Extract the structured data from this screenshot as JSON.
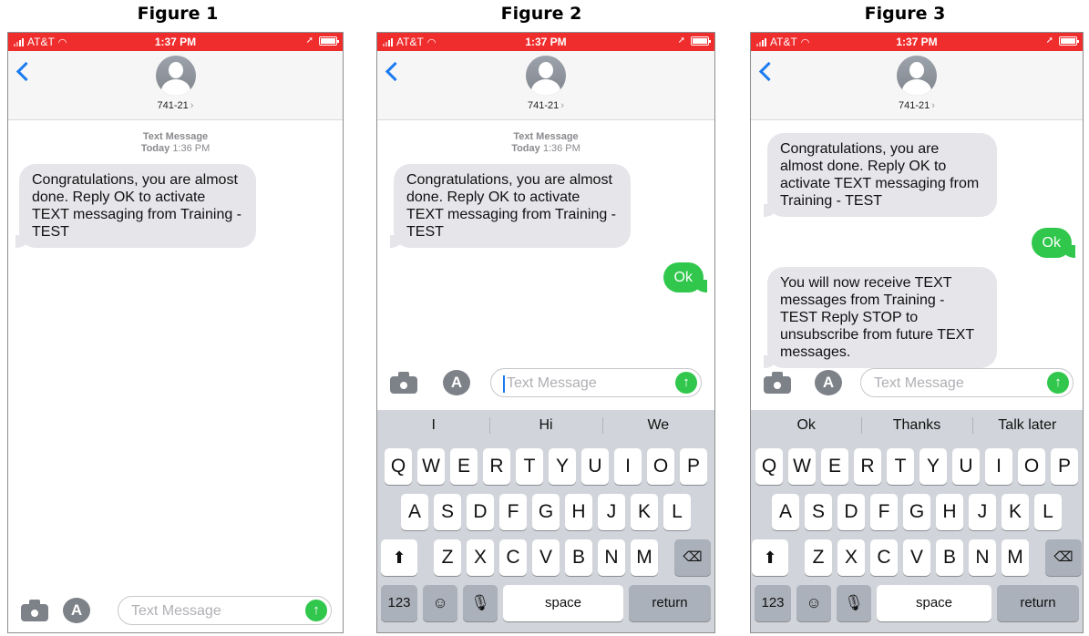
{
  "figures": [
    {
      "title": "Figure 1",
      "status": {
        "carrier": "AT&T",
        "time": "1:37 PM"
      },
      "contact": {
        "name": "741-21",
        "chevron": "›"
      },
      "timestamp": {
        "label": "Text Message",
        "day": "Today",
        "time": "1:36 PM"
      },
      "messages": [
        {
          "dir": "in",
          "text": "Congratulations, you are almost done. Reply OK to activate TEXT messaging from Training - TEST"
        }
      ],
      "input": {
        "placeholder": "Text Message",
        "focused": false
      },
      "keyboard_visible": false
    },
    {
      "title": "Figure 2",
      "status": {
        "carrier": "AT&T",
        "time": "1:37 PM"
      },
      "contact": {
        "name": "741-21",
        "chevron": "›"
      },
      "timestamp": {
        "label": "Text Message",
        "day": "Today",
        "time": "1:36 PM"
      },
      "messages": [
        {
          "dir": "in",
          "text": "Congratulations, you are almost done. Reply OK to activate TEXT messaging from Training - TEST"
        },
        {
          "dir": "out",
          "text": "Ok"
        }
      ],
      "input": {
        "placeholder": "Text Message",
        "focused": true
      },
      "keyboard_visible": true,
      "suggestions": [
        "I",
        "Hi",
        "We"
      ]
    },
    {
      "title": "Figure 3",
      "status": {
        "carrier": "AT&T",
        "time": "1:37 PM"
      },
      "contact": {
        "name": "741-21",
        "chevron": "›"
      },
      "messages": [
        {
          "dir": "in",
          "text": "Congratulations, you are almost done. Reply OK to activate TEXT messaging from Training - TEST"
        },
        {
          "dir": "out",
          "text": "Ok"
        },
        {
          "dir": "in",
          "text": "You will now receive TEXT messages from Training - TEST Reply STOP to unsubscribe from future TEXT messages."
        }
      ],
      "input": {
        "placeholder": "Text Message",
        "focused": false
      },
      "keyboard_visible": true,
      "suggestions": [
        "Ok",
        "Thanks",
        "Talk later"
      ]
    }
  ],
  "keyboard": {
    "row1": [
      "Q",
      "W",
      "E",
      "R",
      "T",
      "Y",
      "U",
      "I",
      "O",
      "P"
    ],
    "row2": [
      "A",
      "S",
      "D",
      "F",
      "G",
      "H",
      "J",
      "K",
      "L"
    ],
    "row3": [
      "Z",
      "X",
      "C",
      "V",
      "B",
      "N",
      "M"
    ],
    "numbers_label": "123",
    "space_label": "space",
    "return_label": "return",
    "shift_glyph": "⬆",
    "delete_glyph": "⌫",
    "emoji_glyph": "☺",
    "mic_glyph": "🎙"
  },
  "icons": {
    "back": "chevron-left-icon",
    "avatar": "person-icon",
    "camera": "camera-icon",
    "appstore": "app-store-icon",
    "send": "arrow-up-icon",
    "send_glyph": "↑",
    "appstore_glyph": "A"
  },
  "colors": {
    "status_bar": "#f02d2d",
    "accent_blue": "#1a7bf0",
    "sent_bubble": "#30c74c",
    "received_bubble": "#e5e5ea",
    "keyboard_bg": "#d1d4da"
  }
}
